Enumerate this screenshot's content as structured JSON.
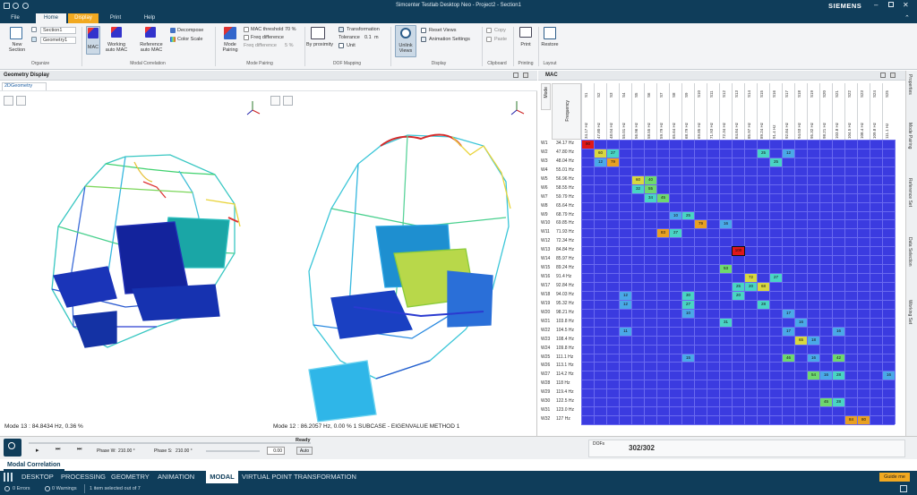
{
  "window": {
    "title": "Simcenter Testlab Desktop Neo - Project2 - Section1",
    "brand": "SIEMENS"
  },
  "menu": {
    "tabs": [
      {
        "label": "File",
        "state": "normal"
      },
      {
        "label": "Home",
        "state": "active"
      },
      {
        "label": "Display",
        "state": "highlight"
      },
      {
        "label": "Print",
        "state": "normal"
      },
      {
        "label": "Help",
        "state": "normal"
      }
    ]
  },
  "ribbon": {
    "organize": {
      "new_section": "New Section",
      "dropdown1": "Section1",
      "dropdown2": "Geometry1",
      "group": "Organize"
    },
    "modal_correlation": {
      "mac": "MAC",
      "working_auto_mac": "Working auto MAC",
      "reference_auto_mac": "Reference auto MAC",
      "decompose": "Decompose",
      "color_scale": "Color Scale",
      "group": "Modal Correlation"
    },
    "mode_pairing": {
      "mode_pairing": "Mode Pairing",
      "mac_threshold": "MAC threshold",
      "mac_threshold_value": "70 %",
      "freq_difference": "Freq difference",
      "freq_difference2": "Freq difference",
      "freq_difference2_value": "5 %",
      "group": "Mode Pairing"
    },
    "dof_mapping": {
      "by_proximity": "By proximity",
      "transformation": "Transformation",
      "tolerance": "Tolerance",
      "tolerance_value": "0.1",
      "tolerance_unit": "m",
      "unit": "Unit",
      "group": "DOF Mapping"
    },
    "display": {
      "unlink_views": "Unlink Views",
      "reset_views": "Reset Views",
      "animation_settings": "Animation Settings",
      "group": "Display"
    },
    "clipboard": {
      "copy": "Copy",
      "paste": "Paste",
      "group": "Clipboard"
    },
    "printing": {
      "print": "Print",
      "group": "Printing"
    },
    "layout": {
      "restore": "Restore",
      "group": "Layout"
    }
  },
  "geometry": {
    "panel_title": "Geometry Display",
    "tab": "2DGeometry",
    "left_caption": "Mode 13 : 84.8434 Hz, 0.36 %",
    "right_caption": "Mode 12 : 86.2057 Hz, 0.00 % 1  SUBCASE - EIGENVALUE METHOD 1"
  },
  "mac": {
    "panel_title": "MAC",
    "row_axis_title": "Mode",
    "freq_axis_title": "Frequency",
    "rows": [
      {
        "mode": "W1",
        "freq": "34.17 Hz"
      },
      {
        "mode": "W2",
        "freq": "47.80 Hz"
      },
      {
        "mode": "W3",
        "freq": "48.04 Hz"
      },
      {
        "mode": "W4",
        "freq": "55.01 Hz"
      },
      {
        "mode": "W5",
        "freq": "56.96 Hz"
      },
      {
        "mode": "W6",
        "freq": "58.55 Hz"
      },
      {
        "mode": "W7",
        "freq": "59.79 Hz"
      },
      {
        "mode": "W8",
        "freq": "65.64 Hz"
      },
      {
        "mode": "W9",
        "freq": "68.79 Hz"
      },
      {
        "mode": "W10",
        "freq": "69.85 Hz"
      },
      {
        "mode": "W11",
        "freq": "71.93 Hz"
      },
      {
        "mode": "W12",
        "freq": "72.34 Hz"
      },
      {
        "mode": "W13",
        "freq": "84.84 Hz"
      },
      {
        "mode": "W14",
        "freq": "85.97 Hz"
      },
      {
        "mode": "W15",
        "freq": "89.24 Hz"
      },
      {
        "mode": "W16",
        "freq": "91.4 Hz"
      },
      {
        "mode": "W17",
        "freq": "92.84 Hz"
      },
      {
        "mode": "W18",
        "freq": "94.03 Hz"
      },
      {
        "mode": "W19",
        "freq": "95.32 Hz"
      },
      {
        "mode": "W20",
        "freq": "98.21 Hz"
      },
      {
        "mode": "W21",
        "freq": "103.8 Hz"
      },
      {
        "mode": "W22",
        "freq": "104.5 Hz"
      },
      {
        "mode": "W23",
        "freq": "108.4 Hz"
      },
      {
        "mode": "W24",
        "freq": "109.8 Hz"
      },
      {
        "mode": "W25",
        "freq": "111.1 Hz"
      },
      {
        "mode": "W26",
        "freq": "113.1 Hz"
      },
      {
        "mode": "W27",
        "freq": "114.2 Hz"
      },
      {
        "mode": "W28",
        "freq": "118 Hz"
      },
      {
        "mode": "W29",
        "freq": "119.4 Hz"
      },
      {
        "mode": "W30",
        "freq": "122.5 Hz"
      },
      {
        "mode": "W31",
        "freq": "123.0 Hz"
      },
      {
        "mode": "W32",
        "freq": "127 Hz"
      }
    ],
    "columns": [
      {
        "mode": "S1",
        "freq": "34.17 Hz"
      },
      {
        "mode": "S2",
        "freq": "47.80 Hz"
      },
      {
        "mode": "S3",
        "freq": "48.04 Hz"
      },
      {
        "mode": "S4",
        "freq": "55.01 Hz"
      },
      {
        "mode": "S5",
        "freq": "56.96 Hz"
      },
      {
        "mode": "S6",
        "freq": "58.55 Hz"
      },
      {
        "mode": "S7",
        "freq": "59.79 Hz"
      },
      {
        "mode": "S8",
        "freq": "65.64 Hz"
      },
      {
        "mode": "S9",
        "freq": "68.79 Hz"
      },
      {
        "mode": "S10",
        "freq": "69.85 Hz"
      },
      {
        "mode": "S11",
        "freq": "71.93 Hz"
      },
      {
        "mode": "S12",
        "freq": "72.34 Hz"
      },
      {
        "mode": "S13",
        "freq": "84.84 Hz"
      },
      {
        "mode": "S14",
        "freq": "85.97 Hz"
      },
      {
        "mode": "S15",
        "freq": "89.24 Hz"
      },
      {
        "mode": "S16",
        "freq": "91.4 Hz"
      },
      {
        "mode": "S17",
        "freq": "92.84 Hz"
      },
      {
        "mode": "S18",
        "freq": "94.03 Hz"
      },
      {
        "mode": "S19",
        "freq": "95.32 Hz"
      },
      {
        "mode": "S20",
        "freq": "98.21 Hz"
      },
      {
        "mode": "S21",
        "freq": "103.8 Hz"
      },
      {
        "mode": "S22",
        "freq": "104.5 Hz"
      },
      {
        "mode": "S23",
        "freq": "108.4 Hz"
      },
      {
        "mode": "S24",
        "freq": "109.8 Hz"
      },
      {
        "mode": "S25",
        "freq": "111.1 Hz"
      }
    ],
    "highlights": [
      {
        "r": 0,
        "c": 0,
        "v": "90"
      },
      {
        "r": 1,
        "c": 1,
        "v": "60"
      },
      {
        "r": 1,
        "c": 2,
        "v": "27"
      },
      {
        "r": 1,
        "c": 14,
        "v": "25"
      },
      {
        "r": 1,
        "c": 16,
        "v": "12"
      },
      {
        "r": 2,
        "c": 1,
        "v": "12"
      },
      {
        "r": 2,
        "c": 2,
        "v": "79"
      },
      {
        "r": 2,
        "c": 15,
        "v": "25"
      },
      {
        "r": 4,
        "c": 4,
        "v": "60"
      },
      {
        "r": 4,
        "c": 5,
        "v": "40"
      },
      {
        "r": 5,
        "c": 4,
        "v": "32"
      },
      {
        "r": 5,
        "c": 5,
        "v": "55"
      },
      {
        "r": 6,
        "c": 5,
        "v": "34"
      },
      {
        "r": 6,
        "c": 6,
        "v": "45"
      },
      {
        "r": 8,
        "c": 7,
        "v": "10"
      },
      {
        "r": 8,
        "c": 8,
        "v": "25"
      },
      {
        "r": 9,
        "c": 9,
        "v": "79"
      },
      {
        "r": 9,
        "c": 11,
        "v": "16"
      },
      {
        "r": 10,
        "c": 6,
        "v": "83"
      },
      {
        "r": 10,
        "c": 7,
        "v": "27"
      },
      {
        "r": 12,
        "c": 12,
        "v": "100"
      },
      {
        "r": 14,
        "c": 11,
        "v": "53"
      },
      {
        "r": 15,
        "c": 13,
        "v": "72"
      },
      {
        "r": 15,
        "c": 15,
        "v": "27"
      },
      {
        "r": 16,
        "c": 12,
        "v": "25"
      },
      {
        "r": 16,
        "c": 13,
        "v": "20"
      },
      {
        "r": 16,
        "c": 14,
        "v": "68"
      },
      {
        "r": 17,
        "c": 3,
        "v": "12"
      },
      {
        "r": 17,
        "c": 8,
        "v": "30"
      },
      {
        "r": 17,
        "c": 12,
        "v": "20"
      },
      {
        "r": 18,
        "c": 3,
        "v": "12"
      },
      {
        "r": 18,
        "c": 8,
        "v": "27"
      },
      {
        "r": 18,
        "c": 14,
        "v": "28"
      },
      {
        "r": 19,
        "c": 8,
        "v": "10"
      },
      {
        "r": 19,
        "c": 16,
        "v": "17"
      },
      {
        "r": 20,
        "c": 11,
        "v": "31"
      },
      {
        "r": 20,
        "c": 17,
        "v": "16"
      },
      {
        "r": 21,
        "c": 3,
        "v": "11"
      },
      {
        "r": 21,
        "c": 16,
        "v": "17"
      },
      {
        "r": 21,
        "c": 20,
        "v": "16"
      },
      {
        "r": 22,
        "c": 17,
        "v": "65"
      },
      {
        "r": 22,
        "c": 18,
        "v": "18"
      },
      {
        "r": 24,
        "c": 8,
        "v": "15"
      },
      {
        "r": 24,
        "c": 16,
        "v": "46"
      },
      {
        "r": 24,
        "c": 18,
        "v": "16"
      },
      {
        "r": 24,
        "c": 20,
        "v": "42"
      },
      {
        "r": 26,
        "c": 18,
        "v": "54"
      },
      {
        "r": 26,
        "c": 19,
        "v": "16"
      },
      {
        "r": 26,
        "c": 20,
        "v": "28"
      },
      {
        "r": 26,
        "c": 24,
        "v": "16"
      },
      {
        "r": 29,
        "c": 19,
        "v": "45"
      },
      {
        "r": 29,
        "c": 20,
        "v": "28"
      },
      {
        "r": 31,
        "c": 21,
        "v": "84"
      },
      {
        "r": 31,
        "c": 22,
        "v": "80"
      }
    ]
  },
  "controls": {
    "ready": "Ready",
    "phase_w_label": "Phase W:",
    "phase_w_value": "210.00 °",
    "phase_s_label": "Phase S:",
    "phase_s_value": "210.00 °",
    "phase_value": "0.00",
    "auto": "Auto",
    "dofs_label": "DOFs",
    "dofs_value": "302/302"
  },
  "modal_bar": {
    "title": "Modal Correlation"
  },
  "bottom_tabs": [
    {
      "label": "DESKTOP",
      "active": false
    },
    {
      "label": "PROCESSING",
      "active": false
    },
    {
      "label": "GEOMETRY",
      "active": false
    },
    {
      "label": "ANIMATION",
      "active": false
    },
    {
      "label": "MODAL",
      "active": true
    },
    {
      "label": "VIRTUAL POINT TRANSFORMATION",
      "active": false
    }
  ],
  "guide_me": "Guide me",
  "status": {
    "errors": "0 Errors",
    "warnings": "0 Warnings",
    "selection": "1 item selected out of 7"
  },
  "side_tabs": [
    "Properties",
    "Mode Pairing",
    "Reference Set",
    "Data Selection",
    "Working Set"
  ],
  "colors": {
    "navy": "#0f3d5a",
    "accent": "#f1a921",
    "mac_low": "#3b3be0",
    "mac_mid": "#49d4c4",
    "mac_high": "#e01818"
  }
}
